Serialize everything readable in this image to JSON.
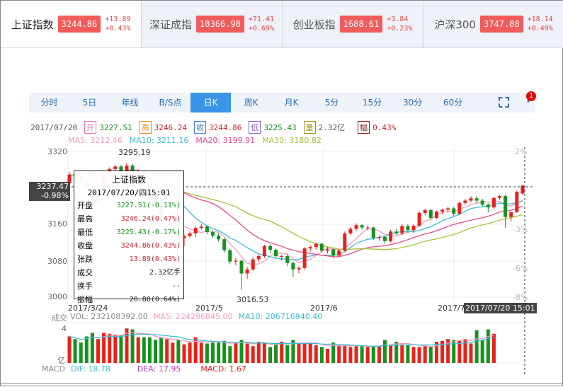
{
  "indices": [
    {
      "name": "上证指数",
      "price": "3244.86",
      "change": "+13.89",
      "pct": "+0.43%",
      "active": true
    },
    {
      "name": "深证成指",
      "price": "10366.98",
      "change": "+71.41",
      "pct": "+0.69%"
    },
    {
      "name": "创业板指",
      "price": "1688.61",
      "change": "+3.84",
      "pct": "+0.23%"
    },
    {
      "name": "沪深300",
      "price": "3747.88",
      "change": "+18.14",
      "pct": "+0.49%"
    }
  ],
  "toolbar": {
    "tabs": [
      "分时",
      "5日",
      "年线",
      "B/S点",
      "日K",
      "周K",
      "月K",
      "5分",
      "15分",
      "30分",
      "60分"
    ],
    "active": "日K",
    "badge": "1"
  },
  "info": {
    "date": "2017/07/20",
    "open_label": "开",
    "open": "3227.51",
    "high_label": "高",
    "high": "3246.24",
    "close_label": "收",
    "close": "3244.86",
    "low_label": "低",
    "low": "3225.43",
    "vol_label": "量",
    "vol": "2.32亿",
    "amp_label": "幅",
    "amp": "0.43%"
  },
  "ma": {
    "ma5": "MA5: 3212.46",
    "ma10": "MA10: 3211.16",
    "ma20": "MA20: 3199.91",
    "ma30": "MA30: 3180.82"
  },
  "colors": {
    "up": "#e8221b",
    "down": "#15931d",
    "ma5": "#f39bbd",
    "ma10": "#3bbdd1",
    "ma20": "#e84a87",
    "ma30": "#a6c23c",
    "accent": "#3a95e8"
  },
  "price_axis": {
    "ticks": [
      "3320",
      "3160",
      "3080",
      "3000"
    ],
    "right_ticks": [
      "2%",
      "-3%",
      "-6%",
      "-8%"
    ],
    "max_label": "3295.19",
    "min_label": "3016.53"
  },
  "date_axis": [
    "2017/3/24",
    "2017/5",
    "2017/6",
    "2017/7"
  ],
  "crosshair": {
    "price": "3237.47",
    "pct": "-0.98%",
    "datetime": "2017/07/20 15:01"
  },
  "tooltip": {
    "title": "上证指数",
    "datetime": "2017/07/20/四15:01",
    "rows": [
      {
        "label": "开盘",
        "value": "3227.51(-0.11%)",
        "color": "down"
      },
      {
        "label": "最高",
        "value": "3246.24(0.47%)",
        "color": "up"
      },
      {
        "label": "最低",
        "value": "3225.43(-0.17%)",
        "color": "down"
      },
      {
        "label": "收盘",
        "value": "3244.86(0.43%)",
        "color": "up"
      },
      {
        "label": "张跌",
        "value": "13.89(0.43%)",
        "color": "up"
      },
      {
        "label": "成交",
        "value": "2.32亿手",
        "color": "plain"
      },
      {
        "label": "换手",
        "value": "--",
        "color": "plain"
      },
      {
        "label": "振幅",
        "value": "20.80(0.64%)",
        "color": "plain"
      }
    ]
  },
  "volume": {
    "label": "成交",
    "vol": "VOL: 232108392.00",
    "ma5": "MA5: 224296845.00",
    "ma10": "MA10: 206716940.40",
    "axis_top": "4",
    "unit": "亿"
  },
  "macd": {
    "label": "MACD",
    "dif": "DIF: 18.78",
    "dea": "DEA: 17.95",
    "macd": "MACD: 1.67"
  },
  "chart_data": {
    "type": "candlestick",
    "ylim": [
      3000,
      3320
    ],
    "ohlc": [
      [
        3250,
        3275,
        3245,
        3269
      ],
      [
        3268,
        3272,
        3258,
        3266
      ],
      [
        3266,
        3270,
        3248,
        3252
      ],
      [
        3252,
        3256,
        3236,
        3241
      ],
      [
        3241,
        3244,
        3205,
        3210
      ],
      [
        3210,
        3228,
        3206,
        3223
      ],
      [
        3230,
        3274,
        3228,
        3270
      ],
      [
        3270,
        3285,
        3265,
        3281
      ],
      [
        3281,
        3290,
        3276,
        3287
      ],
      [
        3287,
        3290,
        3265,
        3269
      ],
      [
        3269,
        3295.19,
        3262,
        3289
      ],
      [
        3289,
        3292,
        3270,
        3274
      ],
      [
        3274,
        3280,
        3266,
        3276
      ],
      [
        3276,
        3278,
        3240,
        3246
      ],
      [
        3246,
        3250,
        3215,
        3222
      ],
      [
        3222,
        3225,
        3190,
        3196
      ],
      [
        3196,
        3200,
        3165,
        3170
      ],
      [
        3170,
        3180,
        3162,
        3172
      ],
      [
        3172,
        3178,
        3165,
        3173
      ],
      [
        3173,
        3175,
        3120,
        3129
      ],
      [
        3129,
        3138,
        3112,
        3134
      ],
      [
        3134,
        3145,
        3130,
        3140
      ],
      [
        3140,
        3156,
        3132,
        3152
      ],
      [
        3152,
        3160,
        3148,
        3155
      ],
      [
        3155,
        3158,
        3138,
        3143
      ],
      [
        3143,
        3146,
        3130,
        3135
      ],
      [
        3135,
        3140,
        3122,
        3127
      ],
      [
        3127,
        3130,
        3098,
        3103
      ],
      [
        3103,
        3106,
        3072,
        3078
      ],
      [
        3078,
        3086,
        3070,
        3080
      ],
      [
        3080,
        3082,
        3016.53,
        3052
      ],
      [
        3052,
        3066,
        3040,
        3061
      ],
      [
        3061,
        3088,
        3058,
        3083
      ],
      [
        3083,
        3094,
        3078,
        3090
      ],
      [
        3090,
        3115,
        3086,
        3112
      ],
      [
        3112,
        3116,
        3098,
        3104
      ],
      [
        3104,
        3108,
        3086,
        3090
      ],
      [
        3090,
        3094,
        3080,
        3090
      ],
      [
        3090,
        3094,
        3068,
        3075
      ],
      [
        3075,
        3078,
        3045,
        3061
      ],
      [
        3061,
        3068,
        3052,
        3064
      ],
      [
        3064,
        3110,
        3060,
        3107
      ],
      [
        3107,
        3114,
        3100,
        3110
      ],
      [
        3110,
        3120,
        3104,
        3117
      ],
      [
        3117,
        3120,
        3098,
        3102
      ],
      [
        3102,
        3110,
        3096,
        3105
      ],
      [
        3105,
        3108,
        3086,
        3091
      ],
      [
        3091,
        3106,
        3088,
        3102
      ],
      [
        3102,
        3144,
        3100,
        3140
      ],
      [
        3140,
        3154,
        3136,
        3150
      ],
      [
        3150,
        3162,
        3146,
        3158
      ],
      [
        3158,
        3160,
        3148,
        3153
      ],
      [
        3153,
        3158,
        3146,
        3153
      ],
      [
        3153,
        3155,
        3126,
        3130
      ],
      [
        3130,
        3136,
        3124,
        3132
      ],
      [
        3132,
        3136,
        3118,
        3123
      ],
      [
        3123,
        3148,
        3120,
        3144
      ],
      [
        3144,
        3150,
        3136,
        3140
      ],
      [
        3140,
        3160,
        3136,
        3156
      ],
      [
        3156,
        3160,
        3142,
        3147
      ],
      [
        3147,
        3160,
        3140,
        3157
      ],
      [
        3157,
        3188,
        3154,
        3185
      ],
      [
        3185,
        3194,
        3180,
        3191
      ],
      [
        3191,
        3194,
        3170,
        3174
      ],
      [
        3174,
        3190,
        3172,
        3188
      ],
      [
        3188,
        3194,
        3182,
        3192
      ],
      [
        3192,
        3198,
        3186,
        3195
      ],
      [
        3195,
        3198,
        3178,
        3183
      ],
      [
        3183,
        3210,
        3180,
        3207
      ],
      [
        3207,
        3216,
        3202,
        3212
      ],
      [
        3212,
        3222,
        3208,
        3217
      ],
      [
        3217,
        3222,
        3206,
        3212
      ],
      [
        3212,
        3216,
        3198,
        3203
      ],
      [
        3203,
        3206,
        3186,
        3197
      ],
      [
        3197,
        3220,
        3194,
        3218
      ],
      [
        3218,
        3224,
        3214,
        3222
      ],
      [
        3222,
        3225,
        3152,
        3176
      ],
      [
        3176,
        3186,
        3166,
        3187
      ],
      [
        3187,
        3234,
        3185,
        3231
      ],
      [
        3227.51,
        3246.24,
        3225.43,
        3244.86
      ]
    ],
    "volume": [
      3.0,
      2.7,
      2.3,
      3.0,
      3.4,
      2.7,
      3.4,
      3.3,
      3.1,
      3.1,
      3.9,
      3.8,
      2.9,
      2.9,
      2.9,
      2.6,
      2.9,
      2.7,
      2.3,
      2.6,
      2.1,
      2.3,
      2.9,
      2.3,
      2.2,
      2.3,
      2.3,
      2.5,
      1.9,
      2.3,
      2.6,
      2.2,
      1.9,
      2.4,
      2.3,
      1.8,
      2.1,
      2.4,
      2.0,
      2.6,
      2.2,
      2.2,
      2.3,
      2.0,
      1.8,
      1.6,
      2.3,
      2.0,
      2.0,
      1.8,
      1.9,
      1.9,
      1.8,
      1.9,
      1.9,
      2.6,
      2.0,
      2.4,
      2.1,
      2.0,
      1.8,
      1.8,
      1.9,
      1.8,
      2.4,
      2.5,
      2.7,
      2.6,
      2.5,
      2.7,
      2.2,
      3.7,
      2.6,
      3.8,
      3.3
    ]
  }
}
